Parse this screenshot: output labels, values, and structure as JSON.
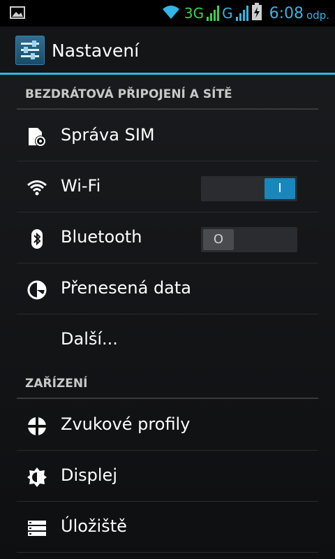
{
  "status_bar": {
    "network_3g": "3G",
    "network_g": "G",
    "time": "6:08",
    "ampm": "odp."
  },
  "action_bar": {
    "title": "Nastavení"
  },
  "sections": {
    "wireless": {
      "title": "BEZDRÁTOVÁ PŘIPOJENÍ A SÍTĚ",
      "items": {
        "sim": {
          "label": "Správa SIM"
        },
        "wifi": {
          "label": "Wi-Fi",
          "toggle": "I",
          "state": "on"
        },
        "bluetooth": {
          "label": "Bluetooth",
          "toggle": "O",
          "state": "off"
        },
        "data": {
          "label": "Přenesená data"
        },
        "more": {
          "label": "Další..."
        }
      }
    },
    "device": {
      "title": "ZAŘÍZENÍ",
      "items": {
        "sound": {
          "label": "Zvukové profily"
        },
        "display": {
          "label": "Displej"
        },
        "storage": {
          "label": "Úložiště"
        }
      }
    }
  },
  "colors": {
    "accent": "#33b5e5",
    "toggle_on": "#1986bd",
    "network_green": "#3bd14b"
  },
  "icons": [
    "image-icon",
    "wifi-icon",
    "signal-icon",
    "battery-icon",
    "settings-icon",
    "sim-icon",
    "bluetooth-icon",
    "data-usage-icon",
    "sound-icon",
    "display-icon",
    "storage-icon"
  ]
}
